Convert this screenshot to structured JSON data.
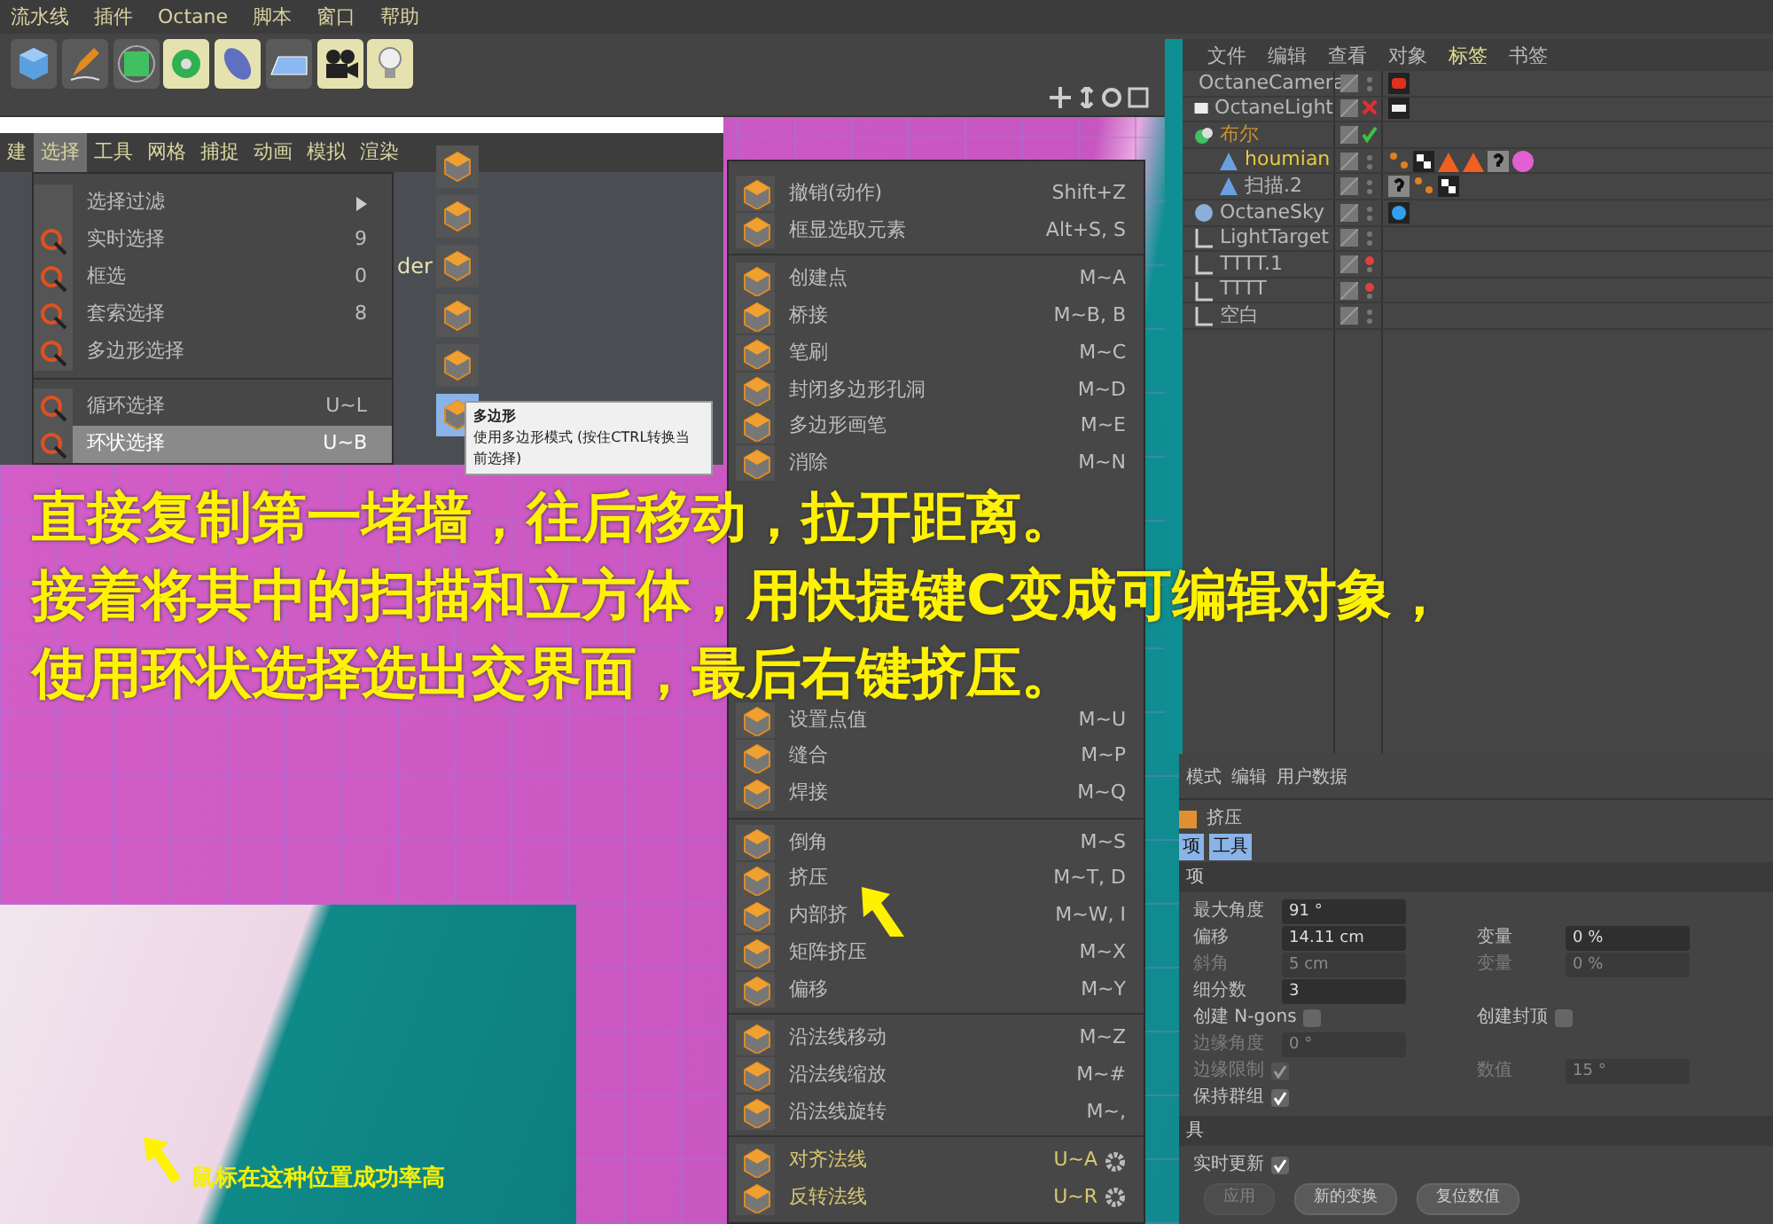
{
  "menubar": [
    {
      "label": "流水线"
    },
    {
      "label": "插件"
    },
    {
      "label": "Octane"
    },
    {
      "label": "脚本"
    },
    {
      "label": "窗口"
    },
    {
      "label": "帮助"
    }
  ],
  "left_panel": {
    "menus": [
      {
        "label": "建",
        "selected": false
      },
      {
        "label": "选择",
        "selected": true
      },
      {
        "label": "工具",
        "selected": false
      },
      {
        "label": "网格",
        "selected": false
      },
      {
        "label": "捕捉",
        "selected": false
      },
      {
        "label": "动画",
        "selected": false
      },
      {
        "label": "模拟",
        "selected": false
      },
      {
        "label": "渲染",
        "selected": false
      }
    ],
    "dropdown": [
      {
        "kind": "submenu",
        "label": "选择过滤",
        "selected": false
      },
      {
        "kind": "item",
        "label": "实时选择",
        "shortcut": "9",
        "selected": false
      },
      {
        "kind": "item",
        "label": "框选",
        "shortcut": "0",
        "selected": false
      },
      {
        "kind": "item",
        "label": "套索选择",
        "shortcut": "8",
        "selected": false
      },
      {
        "kind": "item",
        "label": "多边形选择",
        "selected": false
      },
      {
        "kind": "separator"
      },
      {
        "kind": "item",
        "label": "循环选择",
        "shortcut": "U~L",
        "selected": false
      },
      {
        "kind": "item",
        "label": "环状选择",
        "shortcut": "U~B",
        "selected": true
      }
    ],
    "viewport_label": "der",
    "tooltip": {
      "title": "多边形",
      "text": "使用多边形模式 (按住CTRL转换当前选择)"
    }
  },
  "context_menu": [
    [
      {
        "kind": "item",
        "label": "撤销(动作)",
        "shortcut": "Shift+Z"
      },
      {
        "kind": "item",
        "label": "框显选取元素",
        "shortcut": "Alt+S, S"
      }
    ],
    [
      {
        "kind": "item",
        "label": "创建点",
        "shortcut": "M~A"
      },
      {
        "kind": "item",
        "label": "桥接",
        "shortcut": "M~B, B"
      },
      {
        "kind": "item",
        "label": "笔刷",
        "shortcut": "M~C"
      },
      {
        "kind": "item",
        "label": "封闭多边形孔洞",
        "shortcut": "M~D"
      },
      {
        "kind": "item",
        "label": "多边形画笔",
        "shortcut": "M~E"
      },
      {
        "kind": "item",
        "label": "消除",
        "shortcut": "M~N"
      },
      {
        "kind": "covered"
      },
      {
        "kind": "covered"
      },
      {
        "kind": "covered"
      },
      {
        "kind": "covered"
      },
      {
        "kind": "covered"
      },
      {
        "kind": "covered"
      },
      {
        "kind": "item",
        "label": "设置点值",
        "shortcut": "M~U"
      },
      {
        "kind": "item",
        "label": "缝合",
        "shortcut": "M~P"
      },
      {
        "kind": "item",
        "label": "焊接",
        "shortcut": "M~Q"
      }
    ],
    [
      {
        "kind": "item",
        "label": "倒角",
        "shortcut": "M~S"
      },
      {
        "kind": "item",
        "label": "挤压",
        "shortcut": "M~T, D"
      },
      {
        "kind": "item",
        "label": "内部挤",
        "shortcut": "M~W, I"
      },
      {
        "kind": "item",
        "label": "矩阵挤压",
        "shortcut": "M~X"
      },
      {
        "kind": "item",
        "label": "偏移",
        "shortcut": "M~Y"
      }
    ],
    [
      {
        "kind": "item",
        "label": "沿法线移动",
        "shortcut": "M~Z"
      },
      {
        "kind": "item",
        "label": "沿法线缩放",
        "shortcut": "M~#"
      },
      {
        "kind": "item",
        "label": "沿法线旋转",
        "shortcut": "M~,"
      }
    ],
    [
      {
        "kind": "option",
        "label": "对齐法线",
        "shortcut": "U~A"
      },
      {
        "kind": "option",
        "label": "反转法线",
        "shortcut": "U~R"
      }
    ]
  ],
  "object_manager": {
    "tabs": [
      {
        "label": "文件",
        "selected": false
      },
      {
        "label": "编辑",
        "selected": false
      },
      {
        "label": "查看",
        "selected": false
      },
      {
        "label": "对象",
        "selected": false
      },
      {
        "label": "标签",
        "selected": true
      },
      {
        "label": "书签",
        "selected": false
      }
    ],
    "objects": [
      {
        "name": "OctaneCamera",
        "kind": "camera",
        "color": "#b8b8b8",
        "tags": [
          {
            "kind": "camera"
          }
        ]
      },
      {
        "name": "OctaneLight",
        "kind": "light",
        "color": "#b8b8b8",
        "enabled": false,
        "tags": [
          {
            "kind": "light"
          }
        ]
      },
      {
        "name": "布尔",
        "kind": "boole",
        "color": "#c89030",
        "enabled": true,
        "children": [
          {
            "name": "houmian",
            "kind": "sweep",
            "color": "#e8c840",
            "tags": [
              {
                "kind": "points"
              },
              {
                "kind": "checker"
              },
              {
                "kind": "triangle"
              },
              {
                "kind": "triangle"
              },
              {
                "kind": "unknown"
              },
              {
                "kind": "material"
              }
            ]
          },
          {
            "name": "扫描.2",
            "kind": "sweep",
            "color": "#b8b8b8",
            "tags": [
              {
                "kind": "unknown"
              },
              {
                "kind": "points"
              },
              {
                "kind": "checker"
              }
            ]
          }
        ]
      },
      {
        "name": "OctaneSky",
        "kind": "sky",
        "color": "#b8b8b8",
        "tags": [
          {
            "kind": "sky"
          }
        ]
      },
      {
        "name": "LightTarget",
        "kind": "null",
        "color": "#b8b8b8"
      },
      {
        "name": "TTTT.1",
        "kind": "null",
        "color": "#b8b8b8",
        "visible_in_editor": false
      },
      {
        "name": "TTTT",
        "kind": "null",
        "color": "#b8b8b8",
        "visible_in_editor": false
      },
      {
        "name": "空白",
        "kind": "null",
        "color": "#b8b8b8"
      }
    ]
  },
  "attribute_manager": {
    "menus": [
      "模式",
      "编辑",
      "用户数据"
    ],
    "title": "挤压",
    "tabs": [
      {
        "label": "项",
        "selected": true
      },
      {
        "label": "工具",
        "selected": true
      }
    ],
    "sections": [
      {
        "title": "项",
        "rows": [
          [
            {
              "kind": "number",
              "label": "最大角度",
              "value": "91 °",
              "disabled": false
            }
          ],
          [
            {
              "kind": "number",
              "label": "偏移",
              "value": "14.11 cm",
              "disabled": false
            },
            {
              "kind": "number",
              "label": "变量",
              "value": "0 %",
              "disabled": false
            }
          ],
          [
            {
              "kind": "number",
              "label": "斜角",
              "value": "5 cm",
              "disabled": true
            },
            {
              "kind": "number",
              "label": "变量",
              "value": "0 %",
              "disabled": true
            }
          ],
          [
            {
              "kind": "number",
              "label": "细分数",
              "value": "3",
              "disabled": false
            }
          ],
          [
            {
              "kind": "checkbox",
              "label": "创建 N-gons",
              "checked": false,
              "disabled": false
            },
            {
              "kind": "checkbox",
              "label": "创建封顶",
              "checked": false,
              "disabled": false
            }
          ],
          [
            {
              "kind": "number",
              "label": "边缘角度",
              "value": "0 °",
              "disabled": true
            }
          ],
          [
            {
              "kind": "checkbox",
              "label": "边缘限制",
              "checked": true,
              "disabled": true
            },
            {
              "kind": "number",
              "label": "数值",
              "value": "15 °",
              "disabled": true
            }
          ],
          [
            {
              "kind": "checkbox",
              "label": "保持群组",
              "checked": true,
              "disabled": false
            }
          ]
        ]
      },
      {
        "title": "具",
        "rows": [
          [
            {
              "kind": "checkbox",
              "label": "实时更新",
              "checked": true,
              "disabled": false
            }
          ]
        ]
      }
    ],
    "buttons": [
      {
        "label": "应用",
        "disabled": true
      },
      {
        "label": "新的变换",
        "disabled": false
      },
      {
        "label": "复位数值",
        "disabled": false
      }
    ]
  },
  "overlay_text": [
    "直接复制第一堵墙，往后移动，拉开距离。",
    "接着将其中的扫描和立方体，用快捷键C变成可编辑对象，",
    "使用环状选择选出交界面，最后右键挤压。"
  ],
  "tip_caption": "鼠标在这种位置成功率高"
}
